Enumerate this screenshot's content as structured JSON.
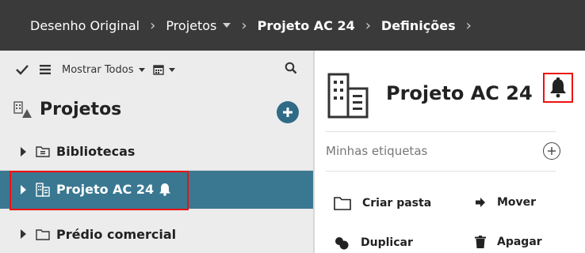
{
  "breadcrumb": {
    "items": [
      {
        "label": "Desenho Original"
      },
      {
        "label": "Projetos"
      },
      {
        "label": "Projeto AC 24"
      },
      {
        "label": "Definições"
      }
    ]
  },
  "toolbar": {
    "show_label": "Mostrar Todos"
  },
  "left_panel": {
    "title": "Projetos",
    "rows": [
      {
        "label": "Bibliotecas"
      },
      {
        "label": "Projeto AC 24"
      },
      {
        "label": "Prédio comercial"
      }
    ]
  },
  "details": {
    "title": "Projeto AC 24",
    "tags_label": "Minhas etiquetas",
    "actions": {
      "create_folder": "Criar pasta",
      "move": "Mover",
      "duplicate": "Duplicar",
      "delete": "Apagar"
    }
  },
  "colors": {
    "topbar": "#3a3a3a",
    "selected_row": "#3a7891",
    "accent": "#2f6b86",
    "highlight": "#ee1111"
  }
}
